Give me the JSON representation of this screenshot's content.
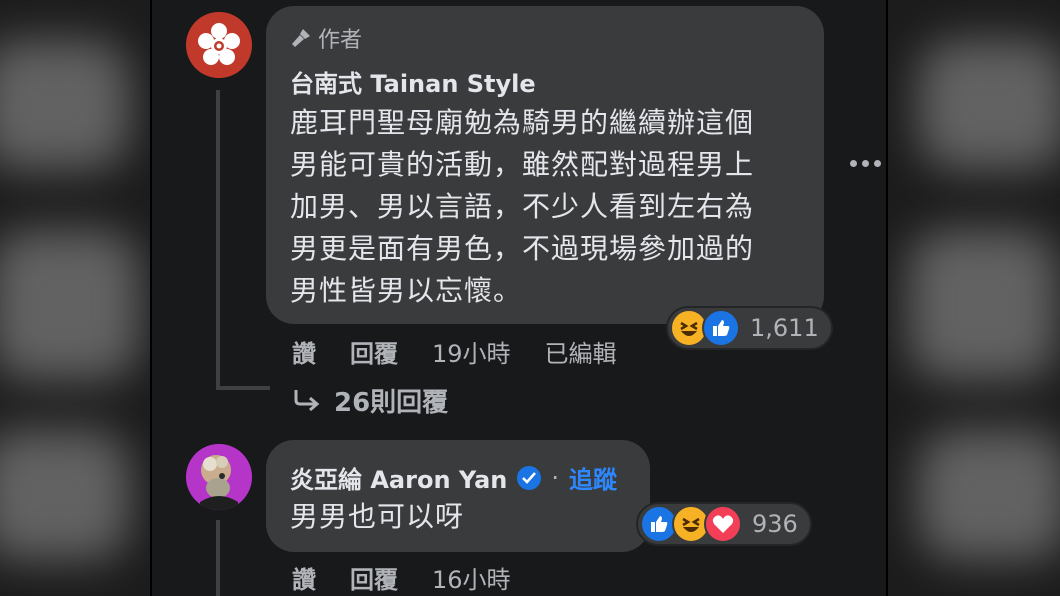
{
  "comments": [
    {
      "author_tag": "作者",
      "name": "台南式 Tainan Style",
      "body_lines": [
        "鹿耳門聖母廟勉為騎男的繼續辦這個",
        "男能可貴的活動，雖然配對過程男上",
        "加男、男以言語，不少人看到左右為",
        "男更是面有男色，不過現場參加過的",
        "男性皆男以忘懷。"
      ],
      "reaction_count": "1,611",
      "reaction_icons": [
        "haha-icon",
        "like-icon"
      ],
      "actions": {
        "like": "讚",
        "reply": "回覆",
        "time": "19小時",
        "edited": "已編輯"
      },
      "replies_label": "26則回覆"
    },
    {
      "name": "炎亞綸 Aaron Yan",
      "follow": "追蹤",
      "body": "男男也可以呀",
      "reaction_count": "936",
      "reaction_icons": [
        "like-icon",
        "haha-icon",
        "love-icon"
      ],
      "actions": {
        "like": "讚",
        "reply": "回覆",
        "time": "16小時"
      }
    }
  ],
  "colors": {
    "feed_bg": "#18191a",
    "bubble_bg": "#3a3b3c",
    "text_primary": "#e4e6eb",
    "text_secondary": "#b0b3b8",
    "link": "#2d88ff",
    "page_avatar": "#c0392b",
    "user_avatar": "#b535c9"
  }
}
